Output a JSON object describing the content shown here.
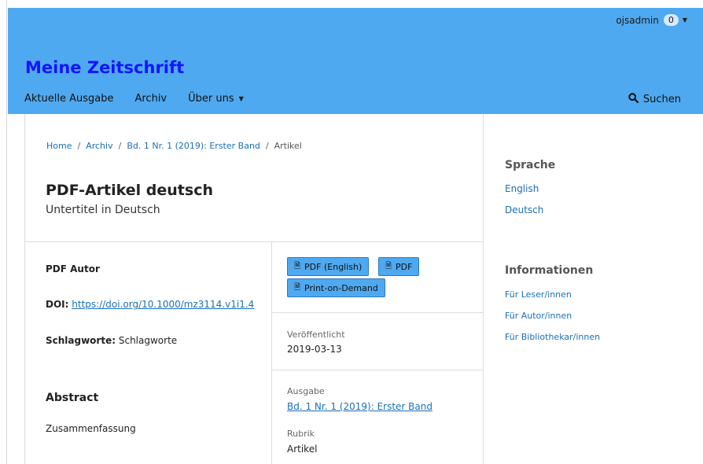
{
  "header": {
    "username": "ojsadmin",
    "notification_count": "0",
    "site_title": "Meine Zeitschrift",
    "nav": [
      {
        "label": "Aktuelle Ausgabe"
      },
      {
        "label": "Archiv"
      },
      {
        "label": "Über uns"
      }
    ],
    "search_label": "Suchen"
  },
  "breadcrumb": {
    "items": [
      "Home",
      "Archiv",
      "Bd. 1 Nr. 1 (2019): Erster Band"
    ],
    "current": "Artikel",
    "separator": "/"
  },
  "article": {
    "title": "PDF-Artikel deutsch",
    "subtitle": "Untertitel in Deutsch",
    "author": "PDF Autor",
    "doi_label": "DOI:",
    "doi_value": "https://doi.org/10.1000/mz3114.v1i1.4",
    "keywords_label": "Schlagworte:",
    "keywords_value": "Schlagworte",
    "abstract_heading": "Abstract",
    "abstract_text": "Zusammenfassung"
  },
  "galleys": [
    {
      "label": "PDF (English)"
    },
    {
      "label": "PDF"
    },
    {
      "label": "Print-on-Demand"
    }
  ],
  "details": {
    "published_label": "Veröffentlicht",
    "published_value": "2019-03-13",
    "issue_label": "Ausgabe",
    "issue_value": "Bd. 1 Nr. 1 (2019): Erster Band",
    "section_label": "Rubrik",
    "section_value": "Artikel"
  },
  "sidebar": {
    "language_heading": "Sprache",
    "languages": [
      "English",
      "Deutsch"
    ],
    "info_heading": "Informationen",
    "info_links": [
      "Für Leser/innen",
      "Für Autor/innen",
      "Für Bibliothekar/innen"
    ]
  },
  "colors": {
    "header_bg": "#4fa9f0",
    "site_title": "#1414ff",
    "link": "#1a6fb8"
  }
}
